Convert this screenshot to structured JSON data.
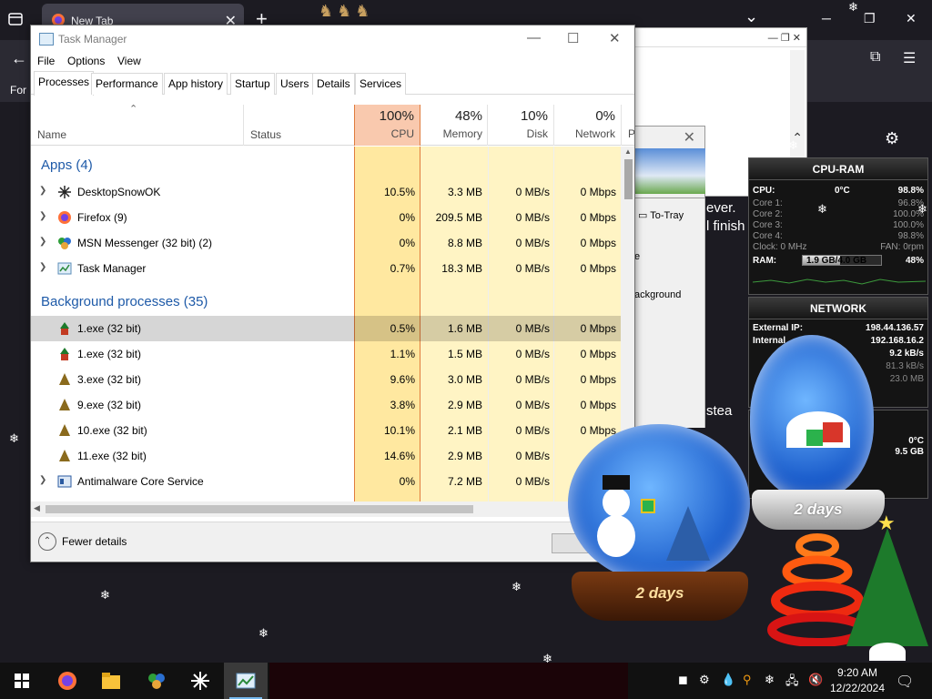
{
  "browser": {
    "tab_title": "New Tab",
    "new_tab": "+",
    "bookmark_label": "For",
    "min": "─",
    "restore": "❐",
    "close": "✕",
    "chevron": "⌄"
  },
  "bg_window": {
    "close_glyph": "✕",
    "to_tray": "To-Tray",
    "text_ever": "ever.",
    "text_finish": "l finish",
    "text_stea": "stea",
    "text_e": "e",
    "text_background": "ackground"
  },
  "taskmgr": {
    "title": "Task Manager",
    "menu": [
      "File",
      "Options",
      "View"
    ],
    "tabs": [
      "Processes",
      "Performance",
      "App history",
      "Startup",
      "Users",
      "Details",
      "Services"
    ],
    "columns": {
      "name": "Name",
      "status": "Status",
      "cpu": {
        "pct": "100%",
        "label": "CPU"
      },
      "memory": {
        "pct": "48%",
        "label": "Memory"
      },
      "disk": {
        "pct": "10%",
        "label": "Disk"
      },
      "network": {
        "pct": "0%",
        "label": "Network"
      },
      "power_initial": "P"
    },
    "groups": {
      "apps": "Apps (4)",
      "background": "Background processes (35)"
    },
    "apps": [
      {
        "name": "DesktopSnowOK",
        "cpu": "10.5%",
        "mem": "3.3 MB",
        "disk": "0 MB/s",
        "net": "0 Mbps"
      },
      {
        "name": "Firefox (9)",
        "cpu": "0%",
        "mem": "209.5 MB",
        "disk": "0 MB/s",
        "net": "0 Mbps"
      },
      {
        "name": "MSN Messenger (32 bit) (2)",
        "cpu": "0%",
        "mem": "8.8 MB",
        "disk": "0 MB/s",
        "net": "0 Mbps"
      },
      {
        "name": "Task Manager",
        "cpu": "0.7%",
        "mem": "18.3 MB",
        "disk": "0 MB/s",
        "net": "0 Mbps"
      }
    ],
    "background": [
      {
        "name": "1.exe (32 bit)",
        "cpu": "0.5%",
        "mem": "1.6 MB",
        "disk": "0 MB/s",
        "net": "0 Mbps"
      },
      {
        "name": "1.exe (32 bit)",
        "cpu": "1.1%",
        "mem": "1.5 MB",
        "disk": "0 MB/s",
        "net": "0 Mbps"
      },
      {
        "name": "3.exe (32 bit)",
        "cpu": "9.6%",
        "mem": "3.0 MB",
        "disk": "0 MB/s",
        "net": "0 Mbps"
      },
      {
        "name": "9.exe (32 bit)",
        "cpu": "3.8%",
        "mem": "2.9 MB",
        "disk": "0 MB/s",
        "net": "0 Mbps"
      },
      {
        "name": "10.exe (32 bit)",
        "cpu": "10.1%",
        "mem": "2.1 MB",
        "disk": "0 MB/s",
        "net": "0 Mbps"
      },
      {
        "name": "11.exe (32 bit)",
        "cpu": "14.6%",
        "mem": "2.9 MB",
        "disk": "0 MB/s",
        "net": "0"
      },
      {
        "name": "Antimalware Core Service",
        "cpu": "0%",
        "mem": "7.2 MB",
        "disk": "0 MB/s",
        "net": "0"
      }
    ],
    "footer": {
      "fewer_details": "Fewer details"
    }
  },
  "cpu_ram": {
    "title": "CPU-RAM",
    "cpu_label": "CPU:",
    "temp": "0°C",
    "cpu_total": "98.8%",
    "cores": [
      {
        "label": "Core 1:",
        "value": "96.8%"
      },
      {
        "label": "Core 2:",
        "value": "100.0%"
      },
      {
        "label": "Core 3:",
        "value": "100.0%"
      },
      {
        "label": "Core 4:",
        "value": "98.8%"
      }
    ],
    "clock": "Clock: 0 MHz",
    "fan": "FAN: 0rpm",
    "ram_label": "RAM:",
    "ram_value": "1.9 GB/4.0 GB",
    "ram_pct": "48%",
    "ram_fraction": 0.48
  },
  "network": {
    "title": "NETWORK",
    "external_label": "External IP:",
    "external_ip": "198.44.136.57",
    "internal_label": "Internal",
    "internal_ip": "192.168.16.2",
    "down": "9.2 kB/s",
    "up": "81.3 kB/s",
    "total": "23.0 MB"
  },
  "lower_gadget": {
    "temp": "0°C",
    "value": "9.5 GB"
  },
  "globes": {
    "left_label": "2 days",
    "right_label": "2 days"
  },
  "taskbar": {
    "time": "9:20 AM",
    "date": "12/22/2024"
  },
  "colors": {
    "cpu_header": "#f9c9ae",
    "cell_heat_low": "#fff4c4",
    "cell_heat_mid": "#ffe8a0",
    "cell_heat_high": "#ffd86b",
    "group_blue": "#1e5aa8"
  }
}
